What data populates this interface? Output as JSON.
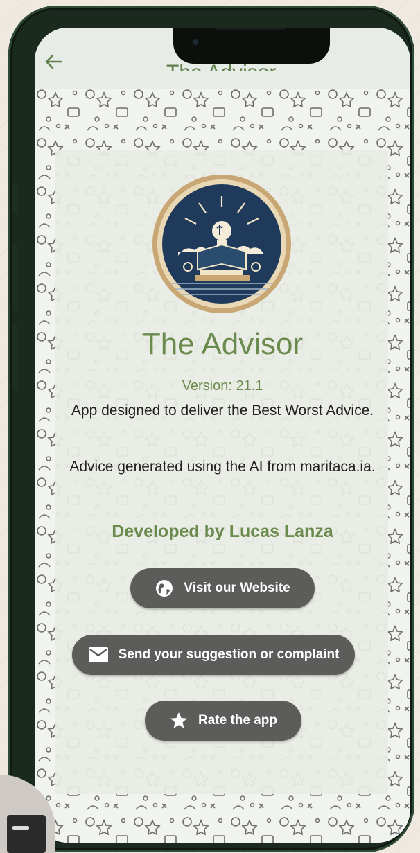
{
  "appbar": {
    "title": "The Advisor"
  },
  "about": {
    "app_name": "The Advisor",
    "version": "Version: 21.1",
    "description": "App designed to deliver the Best Worst Advice.",
    "ai_note": "Advice generated using the AI from maritaca.ia.",
    "developer": "Developed by Lucas Lanza"
  },
  "buttons": {
    "website": "Visit our Website",
    "suggestion": "Send your suggestion or complaint",
    "rate": "Rate the app"
  },
  "icons": {
    "back": "arrow-left-icon",
    "website": "globe-icon",
    "suggestion": "envelope-icon",
    "rate": "star-icon"
  },
  "colors": {
    "accent": "#6b8a4d",
    "button": "#5c5c5a",
    "phone_body": "#1b2a1f"
  }
}
